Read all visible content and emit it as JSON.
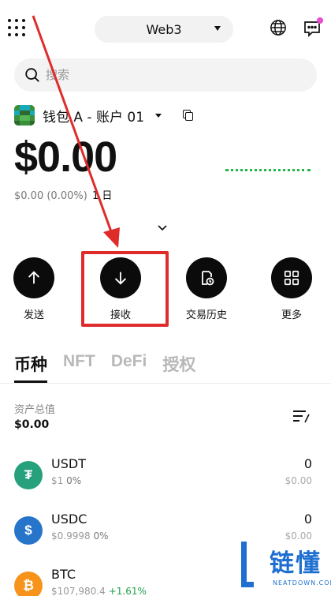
{
  "header": {
    "network_label": "Web3",
    "apps_icon": "grid-icon",
    "globe_icon": "globe-icon",
    "message_icon": "message-icon"
  },
  "search": {
    "placeholder": "搜索"
  },
  "account": {
    "name": "钱包 A - 账户 01",
    "balance": "$0.00",
    "change": "$0.00 (0.00%)",
    "period": "1 日"
  },
  "actions": [
    {
      "label": "发送",
      "icon": "arrow-up-icon"
    },
    {
      "label": "接收",
      "icon": "arrow-down-icon"
    },
    {
      "label": "交易历史",
      "icon": "history-icon"
    },
    {
      "label": "更多",
      "icon": "more-grid-icon"
    }
  ],
  "tabs": [
    "币种",
    "NFT",
    "DeFi",
    "授权"
  ],
  "assets_summary": {
    "label": "资产总值",
    "value": "$0.00"
  },
  "assets": [
    {
      "symbol": "USDT",
      "price": "$1",
      "pct": "0%",
      "pct_up": "",
      "amount": "0",
      "usd": "$0.00",
      "glyph": "₮",
      "color": "#26a17b"
    },
    {
      "symbol": "USDC",
      "price": "$0.9998",
      "pct": "0%",
      "pct_up": "",
      "amount": "0",
      "usd": "$0.00",
      "glyph": "$",
      "color": "#2775ca"
    },
    {
      "symbol": "BTC",
      "price": "$107,980.4",
      "pct": "",
      "pct_up": "+1.61%",
      "amount": "",
      "usd": "",
      "glyph": "₿",
      "color": "#f7931a"
    }
  ],
  "watermark": {
    "cn": "链懂",
    "en": "NEATDOWN.COM"
  },
  "colors": {
    "highlight": "#e02b2b",
    "positive": "#21a249",
    "brand": "#1e6fd0"
  }
}
